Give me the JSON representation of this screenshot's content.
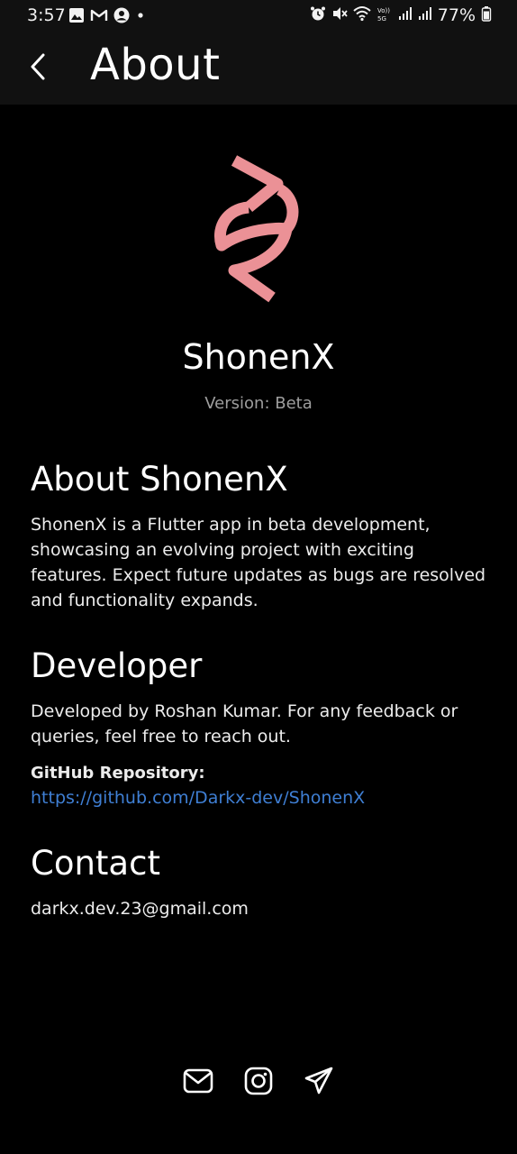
{
  "status_bar": {
    "time": "3:57",
    "battery": "77%",
    "left_icons": [
      "image-icon",
      "gmail-icon",
      "account-icon",
      "dot-icon"
    ],
    "right_icons": [
      "alarm-icon",
      "mute-icon",
      "wifi-icon",
      "volte-icon",
      "signal-icon",
      "signal-icon",
      "battery-icon"
    ]
  },
  "app_bar": {
    "title": "About",
    "back_icon": "chevron-left-icon"
  },
  "app_info": {
    "logo_icon": "shonenx-logo-icon",
    "name": "ShonenX",
    "version": "Version: Beta",
    "logo_color": "#eb9196"
  },
  "about": {
    "heading": "About ShonenX",
    "text": "ShonenX is a Flutter app in beta development, showcasing an evolving project with exciting features. Expect future updates as bugs are resolved and functionality expands."
  },
  "developer": {
    "heading": "Developer",
    "text": "Developed by Roshan Kumar. For any feedback or queries, feel free to reach out.",
    "github_label": "GitHub Repository:",
    "github_url": "https://github.com/Darkx-dev/ShonenX"
  },
  "contact": {
    "heading": "Contact",
    "email": "darkx.dev.23@gmail.com"
  },
  "social": {
    "icons": [
      "mail-icon",
      "instagram-icon",
      "telegram-icon"
    ]
  },
  "colors": {
    "background": "#000000",
    "bar": "#111111",
    "link": "#3f7fd4",
    "muted": "#9e9e9e"
  }
}
